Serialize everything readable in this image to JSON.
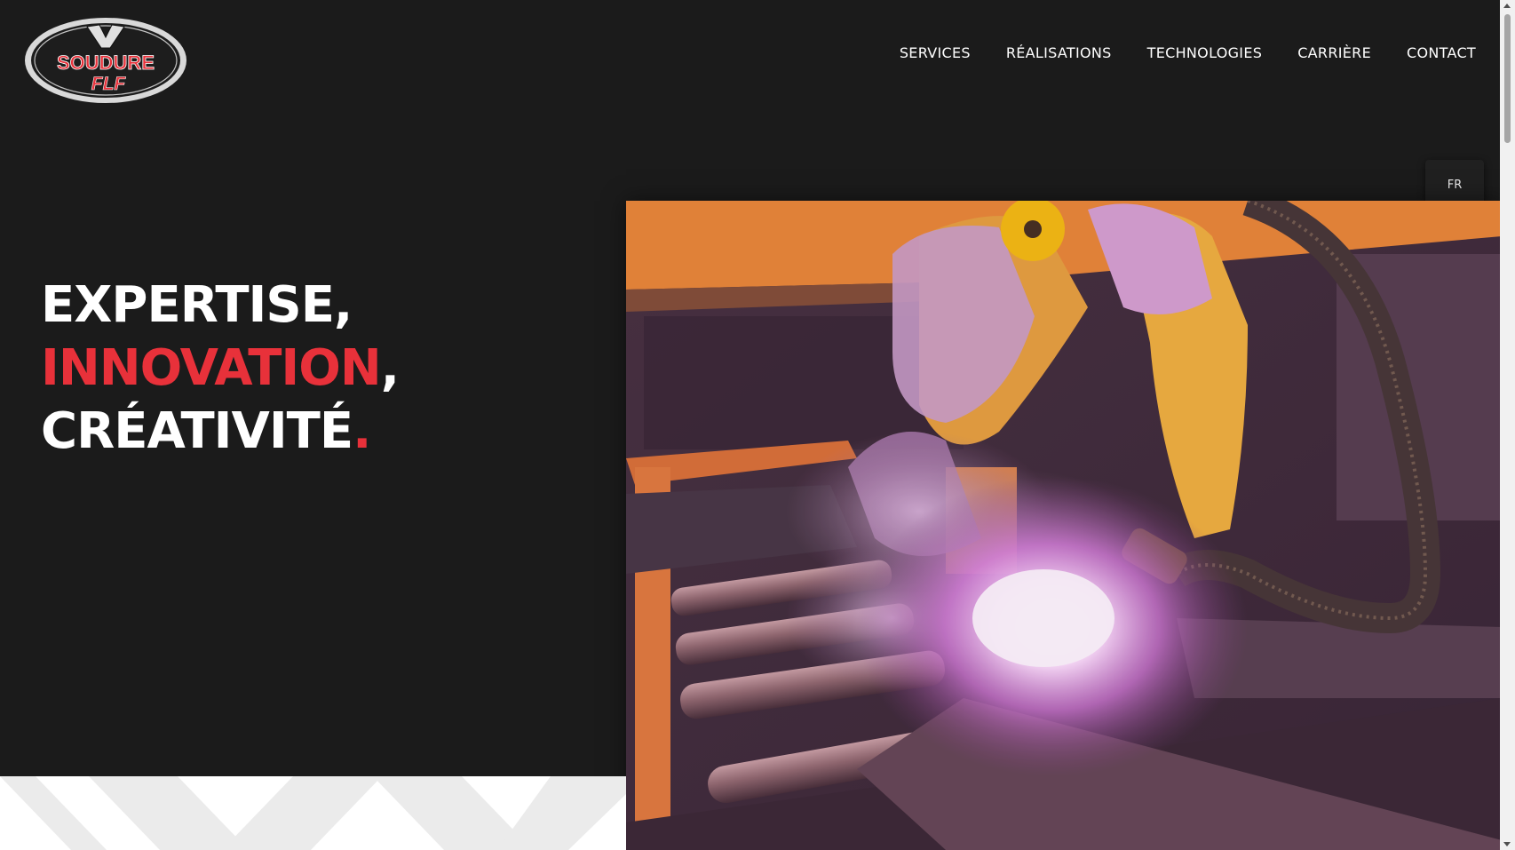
{
  "logo": {
    "line1": "SOUDURE",
    "line2": "FLF"
  },
  "nav": {
    "services": "SERVICES",
    "realisations": "RÉALISATIONS",
    "technologies": "TECHNOLOGIES",
    "carriere": "CARRIÈRE",
    "contact": "CONTACT"
  },
  "language": {
    "label": "FR"
  },
  "hero": {
    "word1": "EXPERTISE",
    "comma1": ",",
    "word2": "INNOVATION",
    "comma2": ",",
    "word3": "CRÉATIVITÉ",
    "period": "."
  },
  "colors": {
    "background": "#1b1b1b",
    "accent": "#e8313a",
    "text": "#ffffff"
  }
}
